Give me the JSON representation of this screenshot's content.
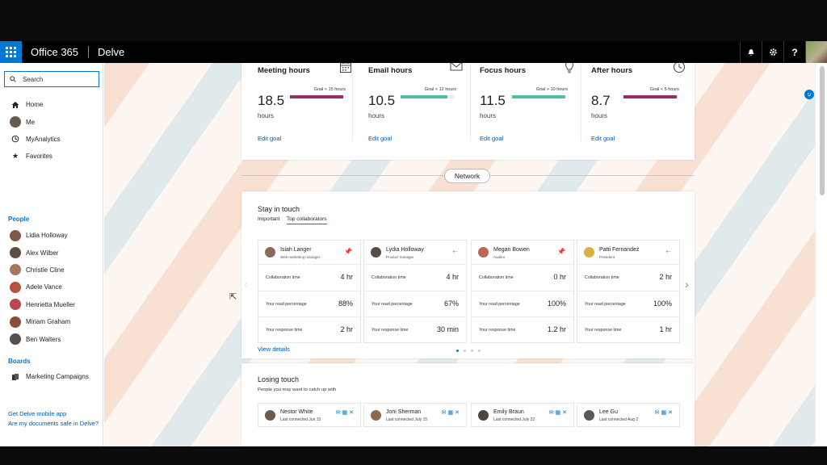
{
  "header": {
    "brand": "Office 365",
    "app": "Delve"
  },
  "search": {
    "placeholder": "Search"
  },
  "nav": {
    "main": [
      {
        "label": "Home",
        "icon": "home-icon"
      },
      {
        "label": "Me",
        "icon": "avatar"
      },
      {
        "label": "MyAnalytics",
        "icon": "analytics-icon"
      },
      {
        "label": "Favorites",
        "icon": "star-icon"
      }
    ],
    "people_heading": "People",
    "people": [
      "Lidia Holloway",
      "Alex Wilber",
      "Christie Cline",
      "Adele Vance",
      "Henrietta Mueller",
      "Miriam Graham",
      "Ben Walters"
    ],
    "boards_heading": "Boards",
    "boards": [
      "Marketing Campaigns"
    ],
    "footer": [
      "Get Delve mobile app",
      "Are my documents safe in Delve?"
    ]
  },
  "goals": [
    {
      "title": "Meeting hours",
      "value": "18.5",
      "unit": "hours",
      "goal": "Goal < 15 hours",
      "progress": 1.0,
      "color": "#9b2b6a",
      "icon": "calendar-icon",
      "edit": "Edit goal"
    },
    {
      "title": "Email hours",
      "value": "10.5",
      "unit": "hours",
      "goal": "Goal < 12 hours",
      "progress": 0.88,
      "color": "#4fbf9f",
      "icon": "mail-icon",
      "edit": "Edit goal"
    },
    {
      "title": "Focus hours",
      "value": "11.5",
      "unit": "hours",
      "goal": "Goal > 10 hours",
      "progress": 1.0,
      "color": "#4fbf9f",
      "icon": "lightbulb-icon",
      "edit": "Edit goal"
    },
    {
      "title": "After hours",
      "value": "8.7",
      "unit": "hours",
      "goal": "Goal < 5 hours",
      "progress": 1.0,
      "color": "#9b2b6a",
      "icon": "clock-icon",
      "edit": "Edit goal"
    }
  ],
  "network": {
    "label": "Network"
  },
  "stay_in_touch": {
    "title": "Stay in touch",
    "tabs": [
      "Important",
      "Top collaborators"
    ],
    "stat_labels": [
      "Collaboration time",
      "Your read percentage",
      "Your response time"
    ],
    "collaborators": [
      {
        "name": "Isiah Langer",
        "role": "Web marketing manager",
        "pinned": true,
        "collab": "4 hr",
        "read": "88%",
        "response": "2 hr"
      },
      {
        "name": "Lydia Holloway",
        "role": "Product manager",
        "pinned": false,
        "collab": "4 hr",
        "read": "67%",
        "response": "30 min"
      },
      {
        "name": "Megan Bowen",
        "role": "Auditor",
        "pinned": true,
        "collab": "0 hr",
        "read": "100%",
        "response": "1.2 hr"
      },
      {
        "name": "Patti Fernandez",
        "role": "President",
        "pinned": false,
        "collab": "2 hr",
        "read": "100%",
        "response": "1 hr"
      }
    ],
    "view_details": "View details"
  },
  "losing_touch": {
    "title": "Losing touch",
    "subtitle": "People you may want to catch up with",
    "people": [
      {
        "name": "Nestor White",
        "last": "Last connected Jun 15"
      },
      {
        "name": "Joni Sherman",
        "last": "Last connected July 15"
      },
      {
        "name": "Emily Braun",
        "last": "Last connected July 22"
      },
      {
        "name": "Lee Gu",
        "last": "Last connected Aug 2"
      }
    ]
  },
  "colors": {
    "accent": "#0078d4",
    "over_goal": "#9b2b6a",
    "on_goal": "#4fbf9f"
  }
}
